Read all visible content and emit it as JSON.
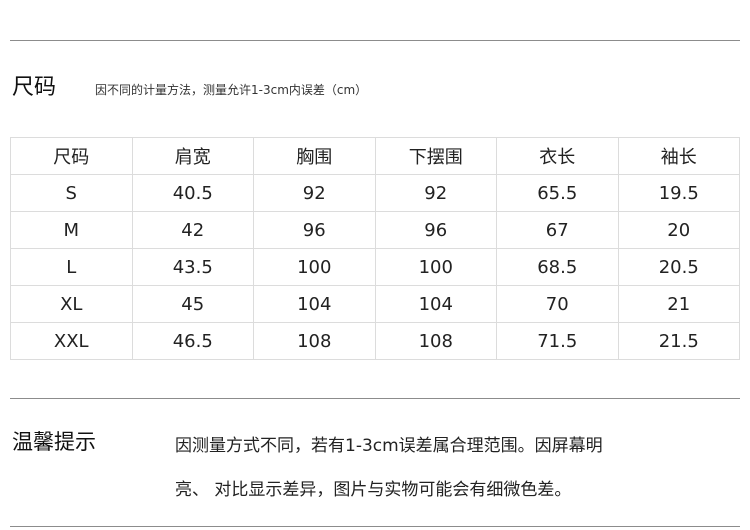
{
  "size_section": {
    "title": "尺码",
    "note": "因不同的计量方法，测量允许1-3cm内误差（cm）"
  },
  "table": {
    "headers": [
      "尺码",
      "肩宽",
      "胸围",
      "下摆围",
      "衣长",
      "袖长"
    ],
    "rows": [
      [
        "S",
        "40.5",
        "92",
        "92",
        "65.5",
        "19.5"
      ],
      [
        "M",
        "42",
        "96",
        "96",
        "67",
        "20"
      ],
      [
        "L",
        "43.5",
        "100",
        "100",
        "68.5",
        "20.5"
      ],
      [
        "XL",
        "45",
        "104",
        "104",
        "70",
        "21"
      ],
      [
        "XXL",
        "46.5",
        "108",
        "108",
        "71.5",
        "21.5"
      ]
    ]
  },
  "tips_section": {
    "title": "温馨提示",
    "line1": "因测量方式不同，若有1-3cm误差属合理范围。因屏幕明",
    "line2": "亮、 对比显示差异，图片与实物可能会有细微色差。"
  }
}
